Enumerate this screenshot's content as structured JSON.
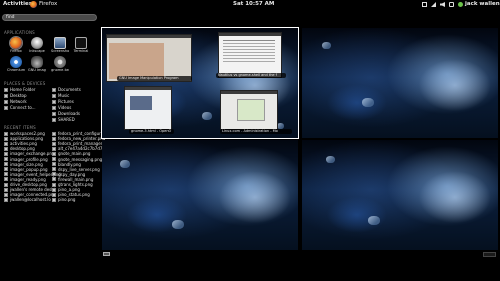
{
  "topbar": {
    "activities": "Activities",
    "app_name": "Firefox",
    "clock": "Sat 10:57 AM",
    "user": "jack wallen"
  },
  "search": {
    "value": "find"
  },
  "applications": {
    "title": "APPLICATIONS",
    "items": [
      {
        "label": "Firefox",
        "icon": "firefox-icon"
      },
      {
        "label": "Inkscape",
        "icon": "inkscape-icon"
      },
      {
        "label": "Screenshot",
        "icon": "screenshot-icon"
      },
      {
        "label": "Terminal",
        "icon": "terminal-icon"
      },
      {
        "label": "Chromium",
        "icon": "chromium-icon"
      },
      {
        "label": "GNU Image",
        "icon": "gimp-icon"
      },
      {
        "label": "gnome-tw",
        "icon": "settings-icon"
      }
    ]
  },
  "places": {
    "title": "PLACES & DEVICES",
    "left": [
      "Home Folder",
      "Desktop",
      "Network",
      "Connect to..."
    ],
    "right": [
      "Documents",
      "Music",
      "Pictures",
      "Videos",
      "Downloads",
      "SHARED"
    ]
  },
  "recent": {
    "title": "RECENT ITEMS",
    "left": [
      "workspaces2.png",
      "applications.png",
      "activities.png",
      "desktop.png",
      "imager_exchange.png",
      "imager_profile.png",
      "imager_size.png",
      "imager_popup.png",
      "imager_event_helper.png",
      "imager_ready.png",
      "drive_desktop.png",
      "jwallen's remote deskt",
      "imager_connected.png",
      "jwallen@localhost.lo"
    ],
    "right": [
      "fedora_print_configuring",
      "fedora_new_printer.png",
      "fedora_print_manager.p",
      "alt_c7e47a4d2c7b7d7c",
      "gnote_main.png",
      "gnote_messaging.png",
      "blandly.png",
      "dspy_live_server.png",
      "dspy_day.png",
      "firewall_main.png",
      "gtrans_lights.png",
      "pino_a.png",
      "pino_status.png",
      "pino.png"
    ]
  },
  "workspace1": {
    "windows": [
      {
        "caption": "GNU Image Manipulation Program"
      },
      {
        "caption": "Nautilus vs gnome-shell and the f"
      },
      {
        "caption": "gnome-3.html - OpenO"
      },
      {
        "caption": "Linux.com - Administration - Mo"
      }
    ]
  },
  "colors": {
    "accent": "#ffffff",
    "background": "#000000",
    "panel_text": "#dddddd"
  }
}
